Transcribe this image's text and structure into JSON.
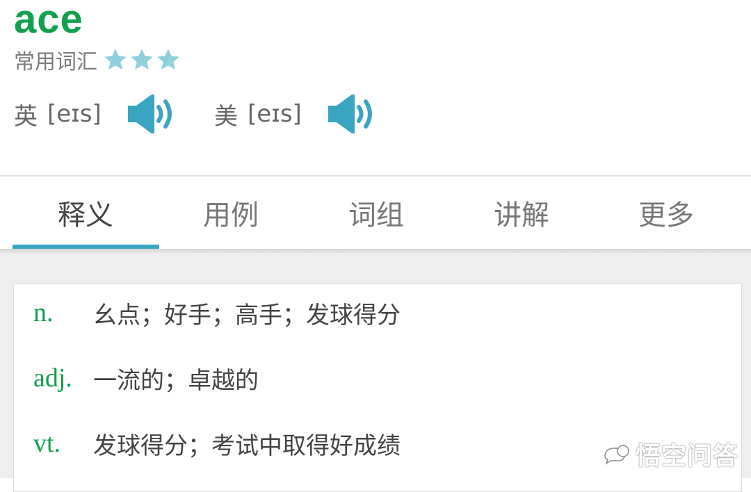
{
  "word": "ace",
  "frequency": {
    "label": "常用词汇",
    "stars": 3,
    "star_color": "#8fd0dc"
  },
  "pronunciations": [
    {
      "region": "英",
      "phonetic": "[eɪs]",
      "icon": "speaker-icon"
    },
    {
      "region": "美",
      "phonetic": "[eɪs]",
      "icon": "speaker-icon"
    }
  ],
  "tabs": [
    {
      "label": "释义",
      "active": true
    },
    {
      "label": "用例",
      "active": false
    },
    {
      "label": "词组",
      "active": false
    },
    {
      "label": "讲解",
      "active": false
    },
    {
      "label": "更多",
      "active": false
    }
  ],
  "definitions": [
    {
      "pos": "n.",
      "meaning": "幺点；好手；高手；发球得分"
    },
    {
      "pos": "adj.",
      "meaning": "一流的；卓越的"
    },
    {
      "pos": "vt.",
      "meaning": "发球得分；考试中取得好成绩"
    }
  ],
  "watermark": {
    "text": "悟空问答",
    "icon": "wukong-logo-icon"
  },
  "colors": {
    "word": "#12a04d",
    "accent": "#3aa5c1",
    "pos": "#12a04d"
  }
}
